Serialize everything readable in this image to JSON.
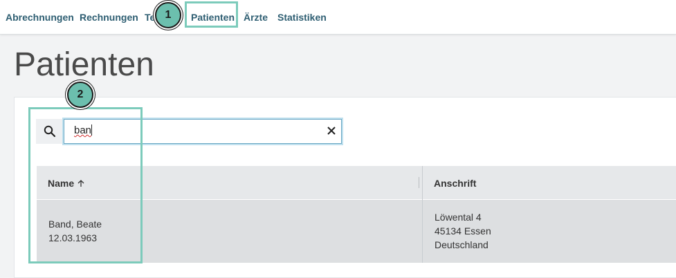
{
  "nav": {
    "items": [
      {
        "label": "Abrechnungen"
      },
      {
        "label": "Rechnungen"
      },
      {
        "label": "Te"
      },
      {
        "label": "Patienten"
      },
      {
        "label": "Ärzte"
      },
      {
        "label": "Statistiken"
      }
    ]
  },
  "page": {
    "title": "Patienten"
  },
  "search": {
    "value": "ban",
    "icon": "search-icon",
    "clear_icon": "close-icon"
  },
  "table": {
    "columns": [
      {
        "label": "Name",
        "sort": "ascending"
      },
      {
        "label": "Anschrift"
      }
    ],
    "rows": [
      {
        "name": "Band, Beate",
        "birthdate": "12.03.1963",
        "address": [
          "Löwental 4",
          "45134 Essen",
          "Deutschland"
        ]
      }
    ]
  },
  "callouts": [
    {
      "number": "1"
    },
    {
      "number": "2"
    }
  ],
  "colors": {
    "accent": "#6cbfae",
    "highlight": "#7ccbbb",
    "nav_text": "#2e5e72"
  }
}
